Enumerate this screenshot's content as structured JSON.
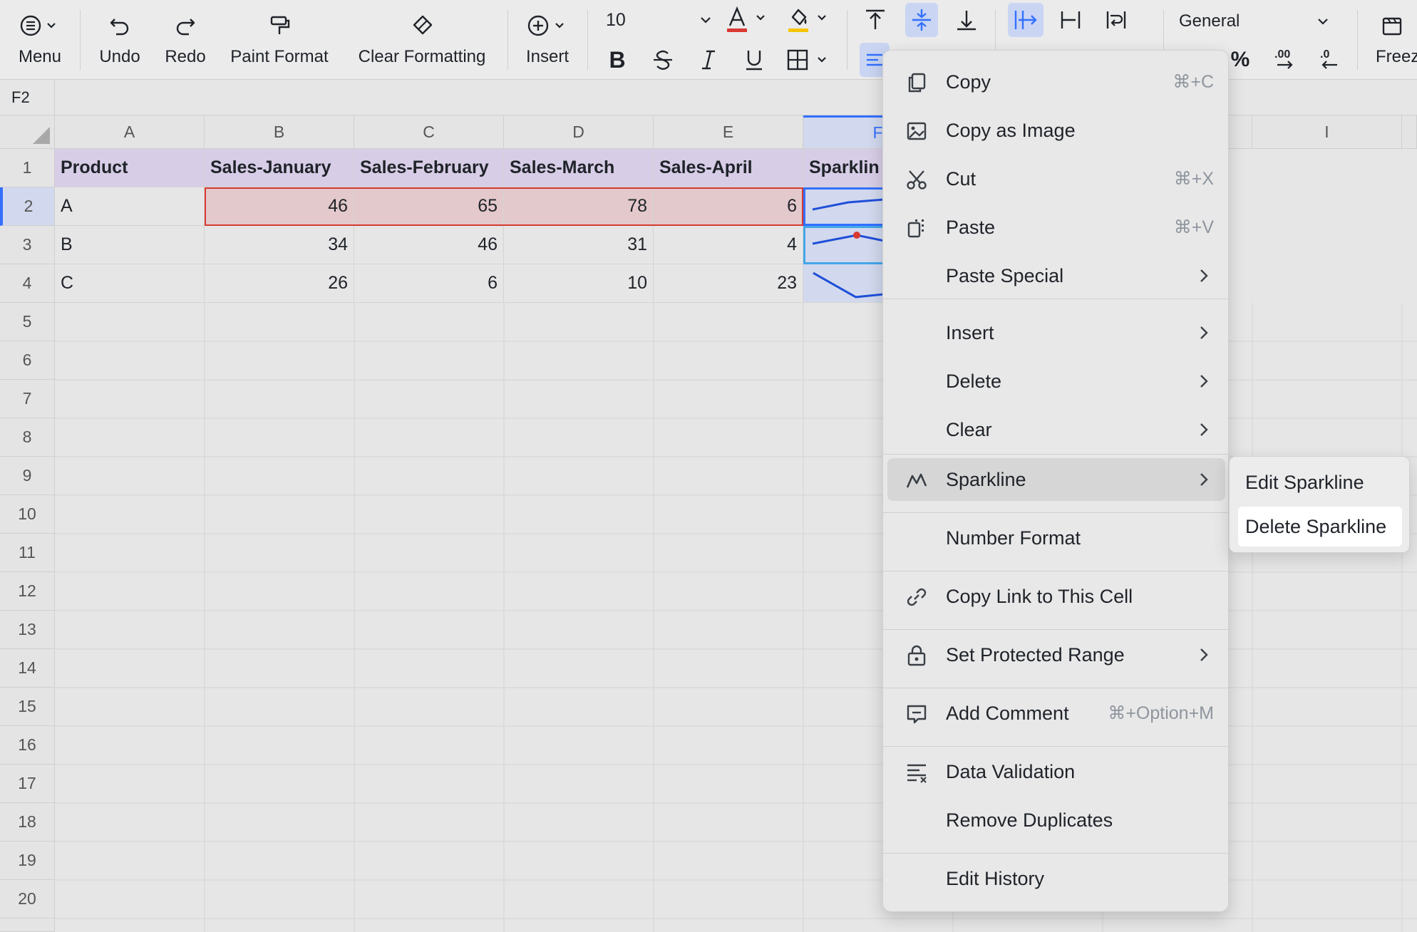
{
  "toolbar": {
    "menu_label": "Menu",
    "undo_label": "Undo",
    "redo_label": "Redo",
    "paint_format_label": "Paint Format",
    "clear_formatting_label": "Clear Formatting",
    "insert_label": "Insert",
    "font_size": "10",
    "number_format": "General",
    "freeze_label": "Freez",
    "text_color": "#d83931",
    "fill_color": "#f5c400",
    "accent_color": "#3370ff"
  },
  "formula_bar": {
    "cell_ref": "F2"
  },
  "sheet": {
    "columns": [
      "A",
      "B",
      "C",
      "D",
      "E",
      "F",
      "I"
    ],
    "rows": [
      "1",
      "2",
      "3",
      "4",
      "5",
      "6",
      "7",
      "8",
      "9",
      "10",
      "11",
      "12",
      "13",
      "14",
      "15",
      "16",
      "17",
      "18",
      "19",
      "20"
    ],
    "header": [
      "Product",
      "Sales-January",
      "Sales-February",
      "Sales-March",
      "Sales-April",
      "Sparklin"
    ],
    "data": [
      [
        "A",
        "46",
        "65",
        "78",
        "6"
      ],
      [
        "B",
        "34",
        "46",
        "31",
        "4"
      ],
      [
        "C",
        "26",
        "6",
        "10",
        "23"
      ]
    ]
  },
  "context_menu": {
    "items": [
      {
        "label": "Copy",
        "shortcut": "⌘+C",
        "icon": "copy-icon"
      },
      {
        "label": "Copy as Image",
        "shortcut": "",
        "icon": "image-icon"
      },
      {
        "label": "Cut",
        "shortcut": "⌘+X",
        "icon": "scissors-icon"
      },
      {
        "label": "Paste",
        "shortcut": "⌘+V",
        "icon": "paste-icon"
      },
      {
        "label": "Paste Special",
        "shortcut": "",
        "icon": ""
      },
      {
        "label": "Insert",
        "shortcut": "",
        "icon": ""
      },
      {
        "label": "Delete",
        "shortcut": "",
        "icon": ""
      },
      {
        "label": "Clear",
        "shortcut": "",
        "icon": ""
      },
      {
        "label": "Sparkline",
        "shortcut": "",
        "icon": "sparkline-icon"
      },
      {
        "label": "Number Format",
        "shortcut": "",
        "icon": ""
      },
      {
        "label": "Copy Link to This Cell",
        "shortcut": "",
        "icon": "link-icon"
      },
      {
        "label": "Set Protected Range",
        "shortcut": "",
        "icon": "lock-icon"
      },
      {
        "label": "Add Comment",
        "shortcut": "⌘+Option+M",
        "icon": "comment-icon"
      },
      {
        "label": "Data Validation",
        "shortcut": "",
        "icon": "validation-icon"
      },
      {
        "label": "Remove Duplicates",
        "shortcut": "",
        "icon": ""
      },
      {
        "label": "Edit History",
        "shortcut": "",
        "icon": ""
      }
    ]
  },
  "submenu": {
    "items": [
      {
        "label": "Edit Sparkline"
      },
      {
        "label": "Delete Sparkline",
        "selected": true
      }
    ]
  }
}
